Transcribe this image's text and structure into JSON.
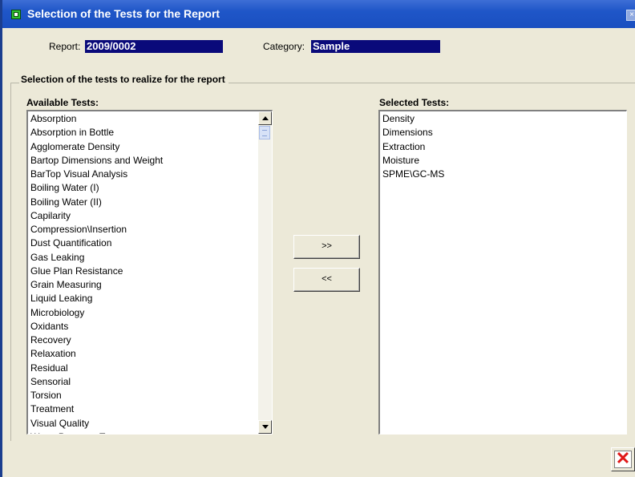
{
  "window": {
    "title": "Selection of the Tests for the Report",
    "close_glyph": "×"
  },
  "header": {
    "report_label": "Report:",
    "report_value": "2009/0002",
    "category_label": "Category:",
    "category_value": "Sample"
  },
  "group": {
    "title": "Selection of the tests to realize for the report"
  },
  "available": {
    "title": "Available Tests:",
    "items": [
      "Absorption",
      "Absorption in Bottle",
      "Agglomerate Density",
      "Bartop Dimensions and Weight",
      "BarTop Visual Analysis",
      "Boiling Water (I)",
      "Boiling Water (II)",
      "Capilarity",
      "Compression\\Insertion",
      "Dust Quantification",
      "Gas Leaking",
      "Glue Plan Resistance",
      "Grain Measuring",
      "Liquid Leaking",
      "Microbiology",
      "Oxidants",
      "Recovery",
      "Relaxation",
      "Residual",
      "Sensorial",
      "Torsion",
      "Treatment",
      "Visual Quality",
      "Water Pressure Test"
    ]
  },
  "selected": {
    "title": "Selected Tests:",
    "items": [
      "Density",
      "Dimensions",
      "Extraction",
      "Moisture",
      "SPME\\GC-MS"
    ]
  },
  "buttons": {
    "add_label": ">>",
    "remove_label": "<<"
  },
  "icons": {
    "app": "app-window-icon",
    "close": "close-icon",
    "exit": "exit-x-icon",
    "scroll_up": "scroll-up-arrow-icon",
    "scroll_down": "scroll-down-arrow-icon"
  },
  "colors": {
    "titlebar": "#1f56c8",
    "field_highlight": "#0a0a7a",
    "window_bg": "#ece9d8",
    "exit_icon": "#e01818"
  }
}
